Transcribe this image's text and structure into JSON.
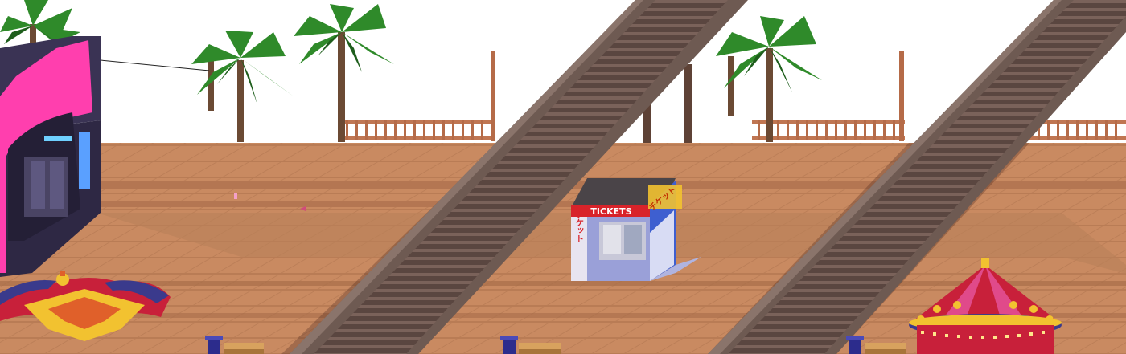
{
  "scene": {
    "type": "isometric pixel-art amusement pier",
    "colors": {
      "sky": "#ffffff",
      "deck": "#c98a61",
      "deck_dark": "#b47652",
      "deck_line": "#a86d49",
      "rail": "#c07652",
      "rail_dark": "#8a4a2e",
      "track_rail": "#6e5a52",
      "track_tie": "#4e3c37",
      "shadow": "rgba(60,30,20,0.28)",
      "palm_leaf": "#2f8a2a",
      "palm_leaf_dark": "#1e5e1c",
      "palm_trunk": "#6b4a34",
      "arcade_neon": "#ff3fae",
      "arcade_body": "#3a3354",
      "booth_red": "#d8232a",
      "booth_blue": "#3e5fd0",
      "carousel_red": "#c8203a",
      "carousel_gold": "#f2c230"
    }
  },
  "ticket_booth": {
    "sign_label": "TICKETS",
    "side_sign_label": "チケット",
    "vertical_sign_label": "チケット"
  },
  "icons": [
    "palm-tree-icon",
    "roller-coaster-track-icon",
    "arcade-building-icon",
    "ticket-booth-icon",
    "carousel-icon",
    "trash-bin-icon",
    "bench-icon"
  ]
}
